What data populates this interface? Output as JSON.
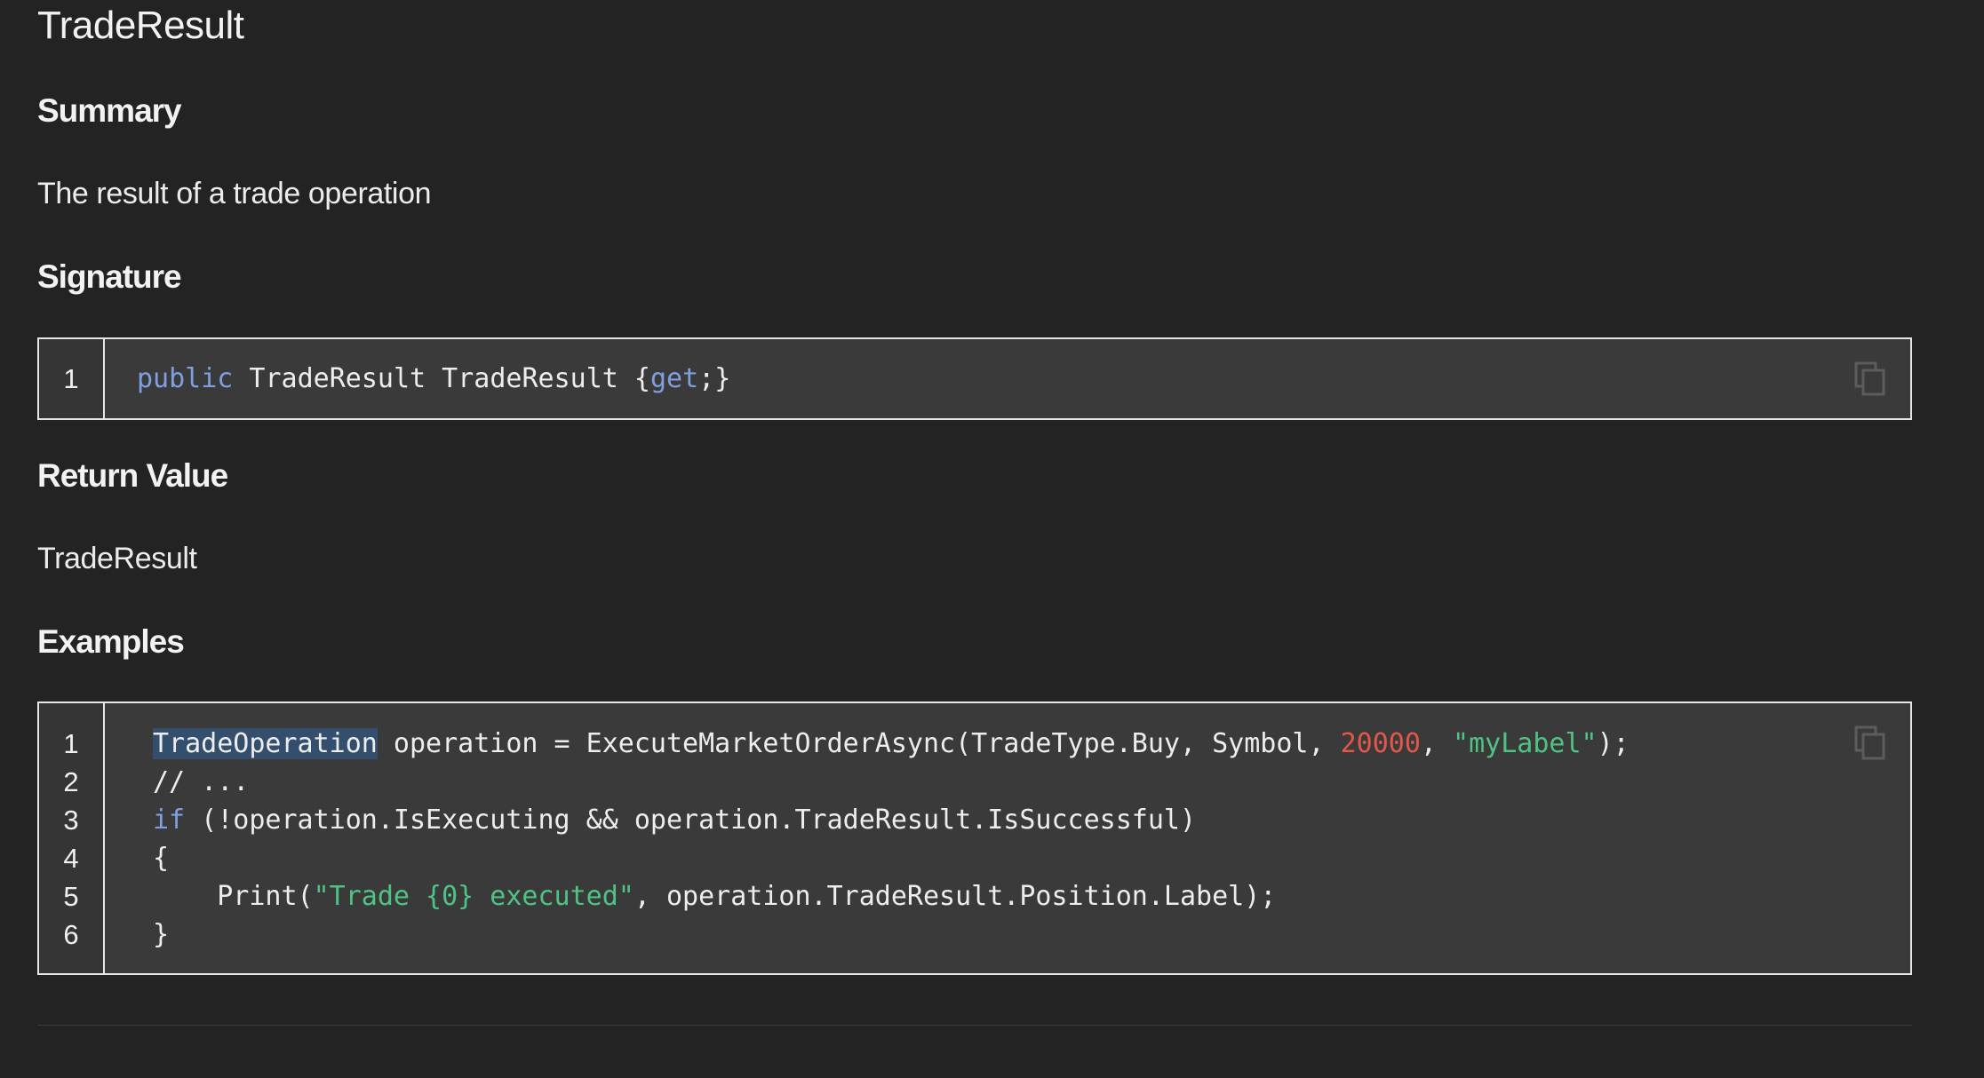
{
  "page": {
    "title": "TradeResult"
  },
  "summary": {
    "heading": "Summary",
    "text": "The result of a trade operation"
  },
  "signature": {
    "heading": "Signature",
    "lines": [
      {
        "number": "1",
        "tokens": [
          {
            "text": "public",
            "kind": "keyword"
          },
          {
            "text": " TradeResult TradeResult {",
            "kind": "plain"
          },
          {
            "text": "get",
            "kind": "keyword"
          },
          {
            "text": ";}",
            "kind": "plain"
          }
        ]
      }
    ],
    "copy_icon": "copy-icon"
  },
  "return_value": {
    "heading": "Return Value",
    "text": "TradeResult"
  },
  "examples": {
    "heading": "Examples",
    "lines": [
      {
        "number": "1",
        "tokens": [
          {
            "text": "TradeOperation",
            "kind": "selected"
          },
          {
            "text": " operation = ExecuteMarketOrderAsync(TradeType.Buy, Symbol, ",
            "kind": "plain"
          },
          {
            "text": "20000",
            "kind": "number"
          },
          {
            "text": ", ",
            "kind": "plain"
          },
          {
            "text": "\"myLabel\"",
            "kind": "string"
          },
          {
            "text": ");",
            "kind": "plain"
          }
        ]
      },
      {
        "number": "2",
        "tokens": [
          {
            "text": "// ...",
            "kind": "plain"
          }
        ]
      },
      {
        "number": "3",
        "tokens": [
          {
            "text": "if",
            "kind": "keyword"
          },
          {
            "text": " (!operation.IsExecuting && operation.TradeResult.IsSuccessful)",
            "kind": "plain"
          }
        ]
      },
      {
        "number": "4",
        "tokens": [
          {
            "text": "{",
            "kind": "plain"
          }
        ]
      },
      {
        "number": "5",
        "tokens": [
          {
            "text": "    Print(",
            "kind": "plain"
          },
          {
            "text": "\"Trade {0} executed\"",
            "kind": "string"
          },
          {
            "text": ", operation.TradeResult.Position.Label);",
            "kind": "plain"
          }
        ]
      },
      {
        "number": "6",
        "tokens": [
          {
            "text": "}",
            "kind": "plain"
          }
        ]
      }
    ],
    "copy_icon": "copy-icon"
  },
  "colors": {
    "background": "#232323",
    "code_background": "#3a3a3a",
    "keyword": "#7f9fe0",
    "string": "#4fc384",
    "number": "#e2574c",
    "selection": "#344e6e"
  }
}
